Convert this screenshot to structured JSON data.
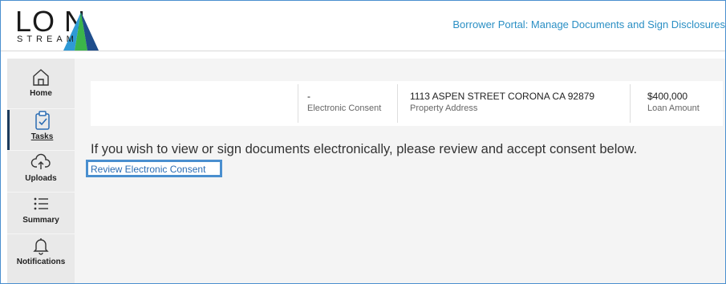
{
  "logo": {
    "top_text": "LO  N",
    "bottom_text": "STREAM",
    "mark_colors": [
      "#2f9ad6",
      "#3bb54a",
      "#1f4e8c"
    ]
  },
  "header": {
    "title": "Borrower Portal: Manage Documents and Sign Disclosures"
  },
  "sidebar": {
    "items": [
      {
        "label": "Home",
        "icon": "home-icon",
        "active": false
      },
      {
        "label": "Tasks",
        "icon": "tasks-clipboard-icon",
        "active": true
      },
      {
        "label": "Uploads",
        "icon": "cloud-upload-icon",
        "active": false
      },
      {
        "label": "Summary",
        "icon": "list-icon",
        "active": false
      },
      {
        "label": "Notifications",
        "icon": "bell-icon",
        "active": false
      }
    ]
  },
  "info_bar": {
    "consent": {
      "value": "-",
      "label": "Electronic Consent"
    },
    "property": {
      "value": "1113 ASPEN STREET CORONA CA 92879",
      "label": "Property Address"
    },
    "loan": {
      "value": "$400,000",
      "label": "Loan Amount"
    }
  },
  "main": {
    "message": "If you wish to view or sign documents electronically, please review and accept consent below.",
    "consent_link": "Review Electronic Consent"
  },
  "colors": {
    "accent": "#2a8fc4",
    "link": "#2a6cb3",
    "frame": "#4a8fcf",
    "sidebar_bg": "#e9e9e9",
    "main_bg": "#f4f4f4"
  }
}
